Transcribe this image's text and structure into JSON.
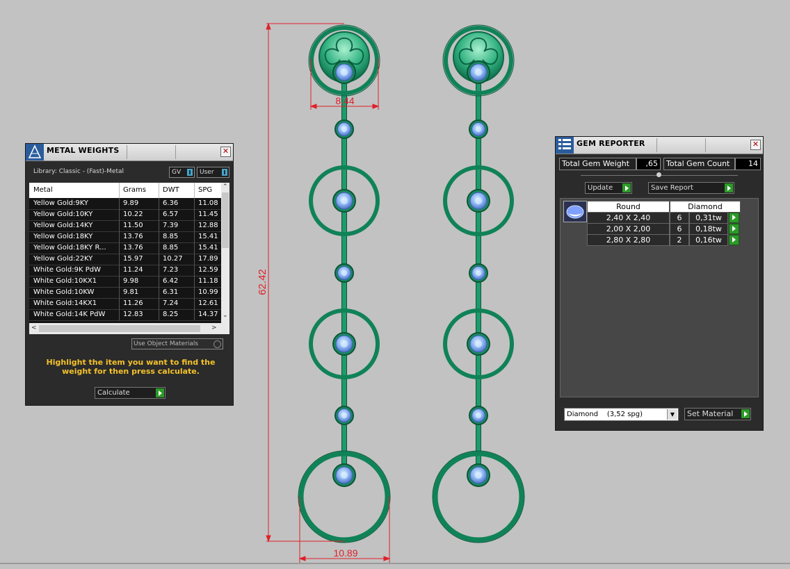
{
  "dimensions": {
    "height": "62.42",
    "top_width": "8.44",
    "bottom_width": "10.89"
  },
  "metal_weights": {
    "title": "METAL WEIGHTS",
    "library": "Library: Classic - (Fast)-Metal",
    "gv_label": "GV",
    "user_label": "User",
    "columns": [
      "Metal",
      "Grams",
      "DWT",
      "SPG"
    ],
    "rows": [
      [
        "Yellow Gold:9KY",
        "9.89",
        "6.36",
        "11.08"
      ],
      [
        "Yellow Gold:10KY",
        "10.22",
        "6.57",
        "11.45"
      ],
      [
        "Yellow Gold:14KY",
        "11.50",
        "7.39",
        "12.88"
      ],
      [
        "Yellow Gold:18KY",
        "13.76",
        "8.85",
        "15.41"
      ],
      [
        "Yellow Gold:18KY R...",
        "13.76",
        "8.85",
        "15.41"
      ],
      [
        "Yellow Gold:22KY",
        "15.97",
        "10.27",
        "17.89"
      ],
      [
        "White Gold:9K PdW",
        "11.24",
        "7.23",
        "12.59"
      ],
      [
        "White Gold:10KX1",
        "9.98",
        "6.42",
        "11.18"
      ],
      [
        "White Gold:10KW",
        "9.81",
        "6.31",
        "10.99"
      ],
      [
        "White Gold:14KX1",
        "11.26",
        "7.24",
        "12.61"
      ],
      [
        "White Gold:14K PdW",
        "12.83",
        "8.25",
        "14.37"
      ]
    ],
    "use_object_materials": "Use Object Materials",
    "hint": "Highlight the item you want to find the weight for then press calculate.",
    "calculate": "Calculate"
  },
  "gem_reporter": {
    "title": "GEM REPORTER",
    "total_weight_label": "Total Gem Weight",
    "total_weight_value": ",65",
    "total_count_label": "Total Gem Count",
    "total_count_value": "14",
    "update": "Update",
    "save_report": "Save Report",
    "head_shape": "Round",
    "head_material": "Diamond",
    "gems": [
      [
        "2,40 X 2,40",
        "6",
        "0,31tw"
      ],
      [
        "2,00 X 2,00",
        "6",
        "0,18tw"
      ],
      [
        "2,80 X 2,80",
        "2",
        "0,16tw"
      ]
    ],
    "material_select": "Diamond    (3,52 spg)",
    "set_material": "Set Material"
  }
}
